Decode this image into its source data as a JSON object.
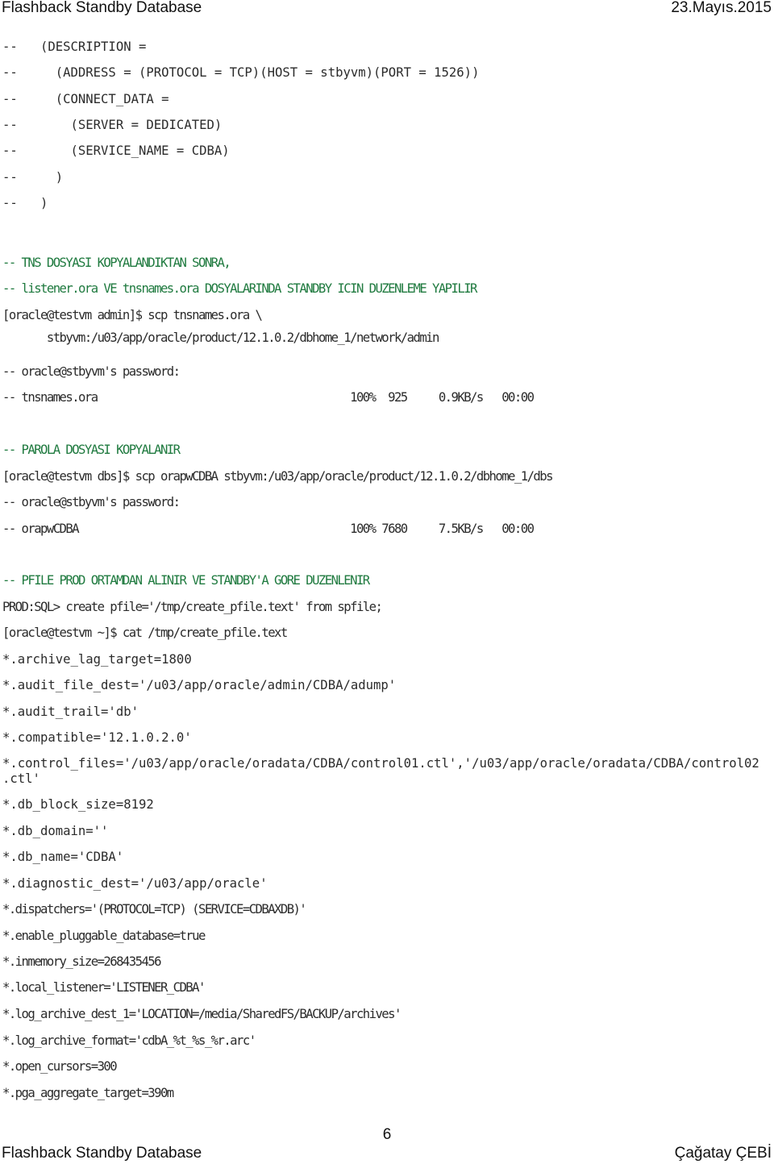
{
  "header": {
    "title": "Flashback Standby Database",
    "date": "23.Mayıs.2015"
  },
  "footer": {
    "page_number": "6",
    "title": "Flashback Standby Database",
    "author": "Çağatay ÇEBİ"
  },
  "colors": {
    "comment": "#1f7a3f",
    "text": "#2b2b2b"
  },
  "lines": [
    {
      "text": "--   (DESCRIPTION =",
      "type": "code"
    },
    {
      "text": "--     (ADDRESS = (PROTOCOL = TCP)(HOST = stbyvm)(PORT = 1526))",
      "type": "code"
    },
    {
      "text": "--     (CONNECT_DATA =",
      "type": "code"
    },
    {
      "text": "--       (SERVER = DEDICATED)",
      "type": "code"
    },
    {
      "text": "--       (SERVICE_NAME = CDBA)",
      "type": "code"
    },
    {
      "text": "--     )",
      "type": "code"
    },
    {
      "text": "--   )",
      "type": "code"
    },
    {
      "text": "-- TNS DOSYASI KOPYALANDIKTAN SONRA,",
      "type": "comment"
    },
    {
      "text": "-- listener.ora VE tnsnames.ora DOSYALARINDA STANDBY ICIN DUZENLEME YAPILIR",
      "type": "comment"
    },
    {
      "text": "[oracle@testvm admin]$ scp tnsnames.ora \\",
      "type": "cond"
    },
    {
      "text": "       stbyvm:/u03/app/oracle/product/12.1.0.2/dbhome_1/network/admin",
      "type": "cond"
    },
    {
      "text": "-- oracle@stbyvm's password:",
      "type": "cond"
    },
    {
      "text": "-- tnsnames.ora                                        100%  925     0.9KB/s   00:00",
      "type": "cond"
    },
    {
      "text": "-- PAROLA DOSYASI KOPYALANIR",
      "type": "comment-cond"
    },
    {
      "text": "[oracle@testvm dbs]$ scp orapwCDBA stbyvm:/u03/app/oracle/product/12.1.0.2/dbhome_1/dbs",
      "type": "cond"
    },
    {
      "text": "-- oracle@stbyvm's password:",
      "type": "cond"
    },
    {
      "text": "-- orapwCDBA                                           100% 7680     7.5KB/s   00:00",
      "type": "cond"
    },
    {
      "text": "-- PFILE PROD ORTAMDAN ALINIR VE STANDBY'A GORE DUZENLENIR",
      "type": "comment-cond"
    },
    {
      "text": "PROD:SQL> create pfile='/tmp/create_pfile.text' from spfile;",
      "type": "cond"
    },
    {
      "text": "[oracle@testvm ~]$ cat /tmp/create_pfile.text",
      "type": "cond"
    },
    {
      "text": "*.archive_lag_target=1800",
      "type": "code"
    },
    {
      "text": "*.audit_file_dest='/u03/app/oracle/admin/CDBA/adump'",
      "type": "code"
    },
    {
      "text": "*.audit_trail='db'",
      "type": "code"
    },
    {
      "text": "*.compatible='12.1.0.2.0'",
      "type": "code"
    },
    {
      "text": "*.control_files='/u03/app/oracle/oradata/CDBA/control01.ctl','/u03/app/oracle/oradata/CDBA/control02",
      "type": "code"
    },
    {
      "text": ".ctl'",
      "type": "code"
    },
    {
      "text": "*.db_block_size=8192",
      "type": "code"
    },
    {
      "text": "*.db_domain=''",
      "type": "code"
    },
    {
      "text": "*.db_name='CDBA'",
      "type": "code"
    },
    {
      "text": "*.diagnostic_dest='/u03/app/oracle'",
      "type": "code"
    },
    {
      "text": "*.dispatchers='(PROTOCOL=TCP) (SERVICE=CDBAXDB)'",
      "type": "cond"
    },
    {
      "text": "*.enable_pluggable_database=true",
      "type": "cond"
    },
    {
      "text": "*.inmemory_size=268435456",
      "type": "cond"
    },
    {
      "text": "*.local_listener='LISTENER_CDBA'",
      "type": "cond"
    },
    {
      "text": "*.log_archive_dest_1='LOCATION=/media/SharedFS/BACKUP/archives'",
      "type": "cond"
    },
    {
      "text": "*.log_archive_format='cdbA_%t_%s_%r.arc'",
      "type": "cond"
    },
    {
      "text": "*.open_cursors=300",
      "type": "cond"
    },
    {
      "text": "*.pga_aggregate_target=390m",
      "type": "cond"
    }
  ]
}
